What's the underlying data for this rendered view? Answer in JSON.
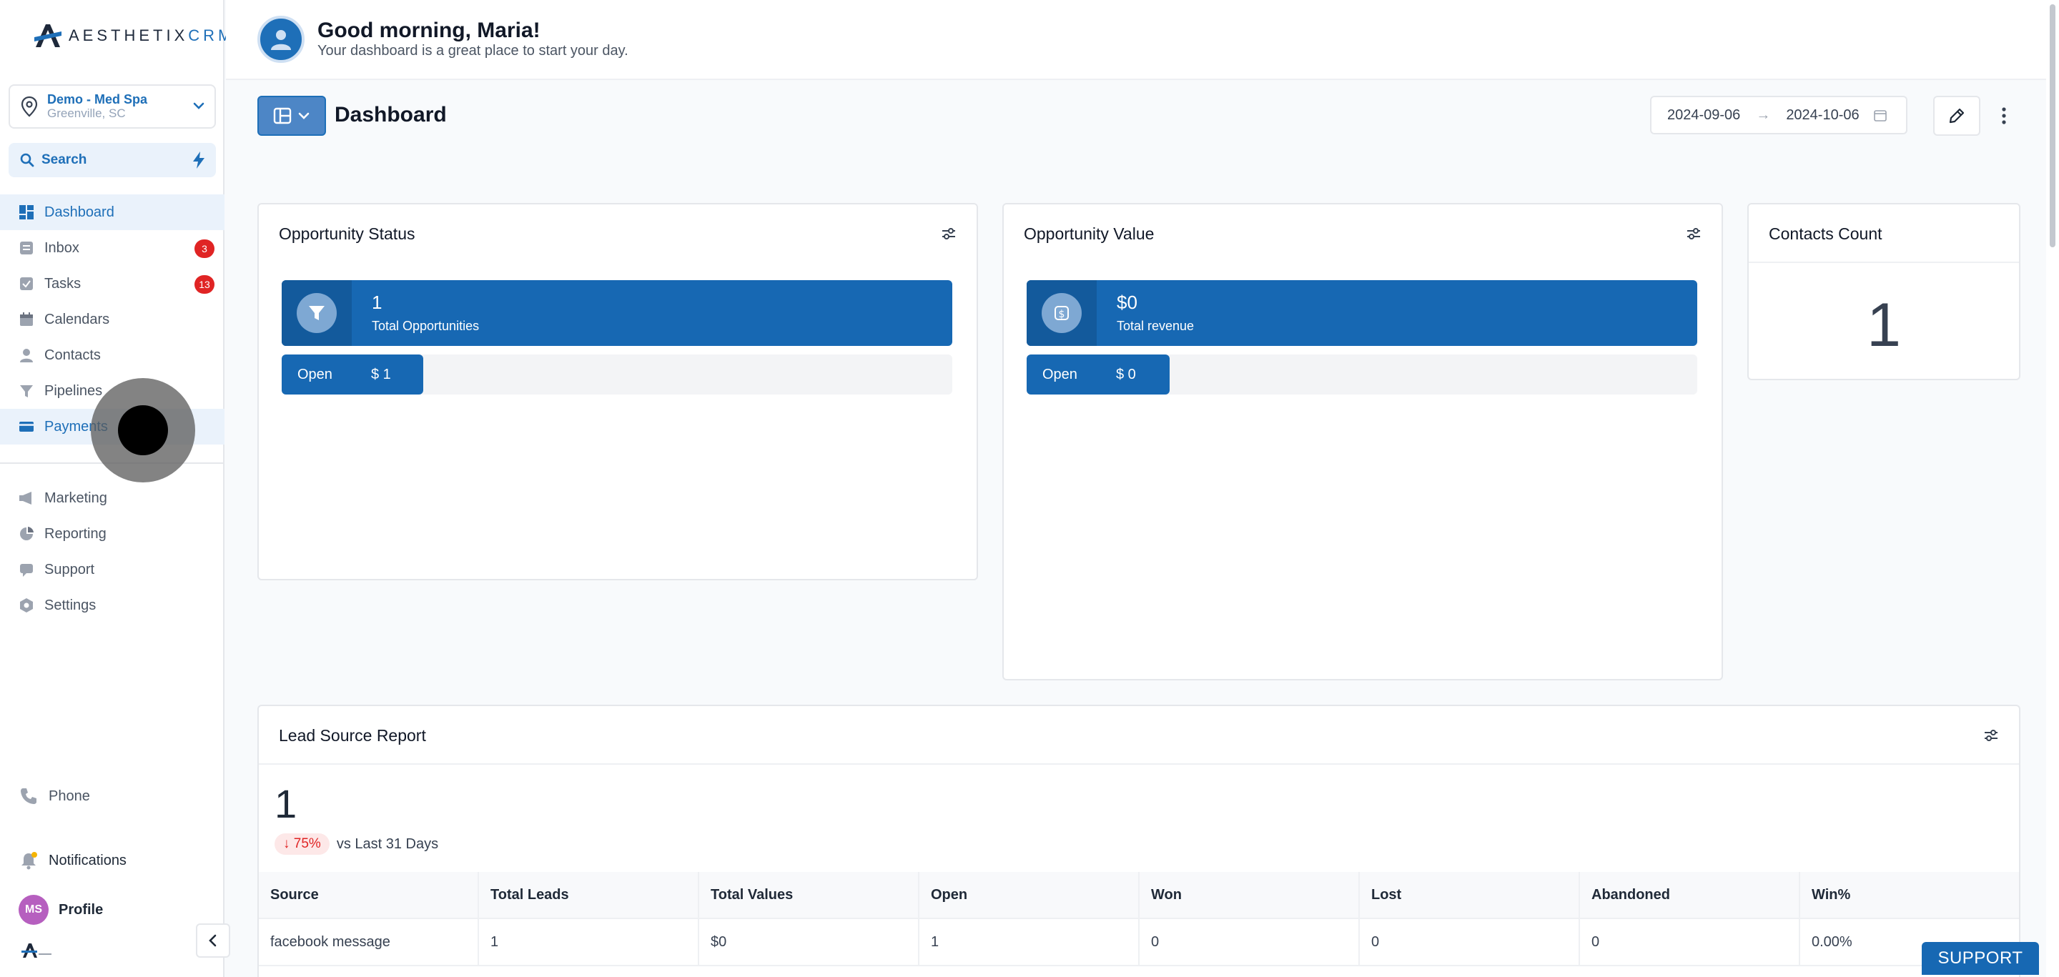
{
  "brand": {
    "name_part1": "AESTHETIX",
    "name_part2": "CRM",
    "accent_color": "#1768b3"
  },
  "location": {
    "name": "Demo - Med Spa",
    "city": "Greenville, SC"
  },
  "search": {
    "label": "Search"
  },
  "sidebar": {
    "items": [
      {
        "label": "Dashboard",
        "icon": "dashboard-icon",
        "active": true
      },
      {
        "label": "Inbox",
        "icon": "inbox-icon",
        "badge": "3"
      },
      {
        "label": "Tasks",
        "icon": "tasks-icon",
        "badge": "13"
      },
      {
        "label": "Calendars",
        "icon": "calendar-icon"
      },
      {
        "label": "Contacts",
        "icon": "contacts-icon"
      },
      {
        "label": "Pipelines",
        "icon": "funnel-icon"
      },
      {
        "label": "Payments",
        "icon": "payments-icon",
        "active": true
      }
    ],
    "items2": [
      {
        "label": "Marketing",
        "icon": "megaphone-icon"
      },
      {
        "label": "Reporting",
        "icon": "reporting-icon"
      },
      {
        "label": "Support",
        "icon": "support-icon"
      },
      {
        "label": "Settings",
        "icon": "gear-icon"
      }
    ],
    "phone": "Phone",
    "notifications": "Notifications",
    "profile_initials": "MS",
    "profile": "Profile"
  },
  "header": {
    "greeting": "Good morning, Maria!",
    "subtitle": "Your dashboard is a great place to start your day."
  },
  "toolbar": {
    "title": "Dashboard",
    "date_from": "2024-09-06",
    "date_arrow": "→",
    "date_to": "2024-10-06"
  },
  "opportunity_status": {
    "title": "Opportunity Status",
    "value": "1",
    "label": "Total Opportunities",
    "open_label": "Open",
    "open_value": "$ 1"
  },
  "opportunity_value": {
    "title": "Opportunity Value",
    "value": "$0",
    "label": "Total revenue",
    "open_label": "Open",
    "open_value": "$ 0"
  },
  "contacts_count": {
    "title": "Contacts Count",
    "value": "1"
  },
  "lead_source": {
    "title": "Lead Source Report",
    "total": "1",
    "delta": "↓ 75%",
    "delta_text": "vs Last 31 Days",
    "columns": [
      "Source",
      "Total Leads",
      "Total Values",
      "Open",
      "Won",
      "Lost",
      "Abandoned",
      "Win%"
    ],
    "rows": [
      [
        "facebook message",
        "1",
        "$0",
        "1",
        "0",
        "0",
        "0",
        "0.00%"
      ]
    ]
  },
  "support_button": "SUPPORT"
}
